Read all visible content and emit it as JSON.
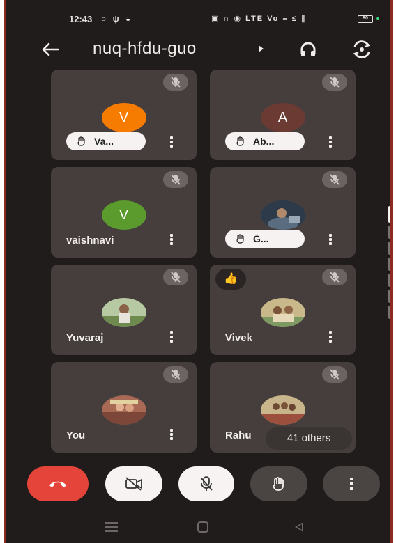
{
  "status_bar": {
    "time": "12:43",
    "left_icons": "○ ψ ◒",
    "right_icons": "▣ ∩ ◉ LTE Vo ≡ ≤ ∥",
    "battery": "80"
  },
  "header": {
    "title": "nuq-hfdu-guo"
  },
  "tiles": [
    {
      "name": "Va...",
      "avatar_letter": "V",
      "avatar_color": "#f57c00",
      "hand_raised": true
    },
    {
      "name": "Ab...",
      "avatar_letter": "A",
      "avatar_color": "#6b3a33",
      "hand_raised": true
    },
    {
      "name": "vaishnavi",
      "avatar_letter": "V",
      "avatar_color": "#5b9b2e",
      "hand_raised": false
    },
    {
      "name": "G...",
      "avatar_letter": "",
      "hand_raised": true
    },
    {
      "name": "Yuvaraj",
      "avatar_letter": "",
      "hand_raised": false
    },
    {
      "name": "Vivek",
      "avatar_letter": "",
      "hand_raised": false,
      "reaction": "👍"
    },
    {
      "name": "You",
      "avatar_letter": "",
      "hand_raised": false
    },
    {
      "name": "Rahu",
      "avatar_letter": "",
      "hand_raised": false
    }
  ],
  "others_pill": "41 others",
  "colors": {
    "background": "#201c1b",
    "tile": "#463e3c",
    "end_call": "#e5443a",
    "control_light": "#f6f3f2",
    "control_dark": "#4a4443"
  }
}
